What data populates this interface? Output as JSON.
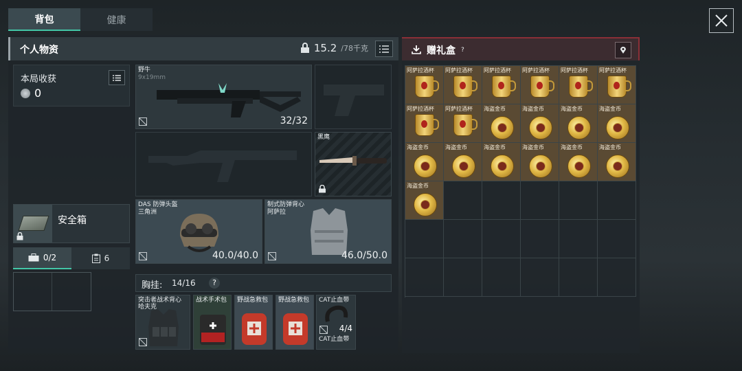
{
  "tabs": [
    {
      "label": "背包"
    },
    {
      "label": "健康"
    }
  ],
  "personal": {
    "title": "个人物资",
    "weight": "15.2",
    "weight_max": "/78千克"
  },
  "harvest": {
    "label": "本局收获",
    "value": "0"
  },
  "safebox": {
    "label": "安全箱"
  },
  "sub_tabs": [
    {
      "label": "0/2"
    },
    {
      "label": "6"
    }
  ],
  "weapons": {
    "primary": {
      "name": "野牛",
      "sub": "9x19mm",
      "ammo": "32/32"
    },
    "knife": {
      "name": "黑鹰"
    }
  },
  "armor": {
    "helmet": {
      "name": "DAS 防弹头盔",
      "sub": "三角洲",
      "durability": "40.0/40.0"
    },
    "vest": {
      "name": "制式防弹背心",
      "sub": "阿萨拉",
      "durability": "46.0/50.0"
    }
  },
  "chest_rig": {
    "label": "胸挂:",
    "capacity": "14/16",
    "items": [
      {
        "name": "突击者战术背心",
        "sub": "哈夫克"
      },
      {
        "name": "战术手术包"
      },
      {
        "name": "野战急救包"
      },
      {
        "name": "野战急救包"
      },
      {
        "name": "CAT止血带",
        "count": "4/4",
        "sub": "CAT止血带"
      }
    ]
  },
  "gift_box": {
    "title": "赠礼盒",
    "help": "?",
    "items": [
      {
        "name": "阿萨拉酒杯",
        "kind": "cup"
      },
      {
        "name": "阿萨拉酒杯",
        "kind": "cup"
      },
      {
        "name": "阿萨拉酒杯",
        "kind": "cup"
      },
      {
        "name": "阿萨拉酒杯",
        "kind": "cup"
      },
      {
        "name": "阿萨拉酒杯",
        "kind": "cup"
      },
      {
        "name": "阿萨拉酒杯",
        "kind": "cup"
      },
      {
        "name": "阿萨拉酒杯",
        "kind": "cup"
      },
      {
        "name": "阿萨拉酒杯",
        "kind": "cup"
      },
      {
        "name": "海盗金币",
        "kind": "coin"
      },
      {
        "name": "海盗金币",
        "kind": "coin"
      },
      {
        "name": "海盗金币",
        "kind": "coin"
      },
      {
        "name": "海盗金币",
        "kind": "coin"
      },
      {
        "name": "海盗金币",
        "kind": "coin"
      },
      {
        "name": "海盗金币",
        "kind": "coin"
      },
      {
        "name": "海盗金币",
        "kind": "coin"
      },
      {
        "name": "海盗金币",
        "kind": "coin"
      },
      {
        "name": "海盗金币",
        "kind": "coin"
      },
      {
        "name": "海盗金币",
        "kind": "coin"
      },
      {
        "name": "海盗金币",
        "kind": "coin"
      }
    ],
    "total_cells": 36
  },
  "colors": {
    "accent": "#43c7a7",
    "gift_accent": "#8b2f37",
    "gold": "#e1b845"
  },
  "help_label": "?"
}
